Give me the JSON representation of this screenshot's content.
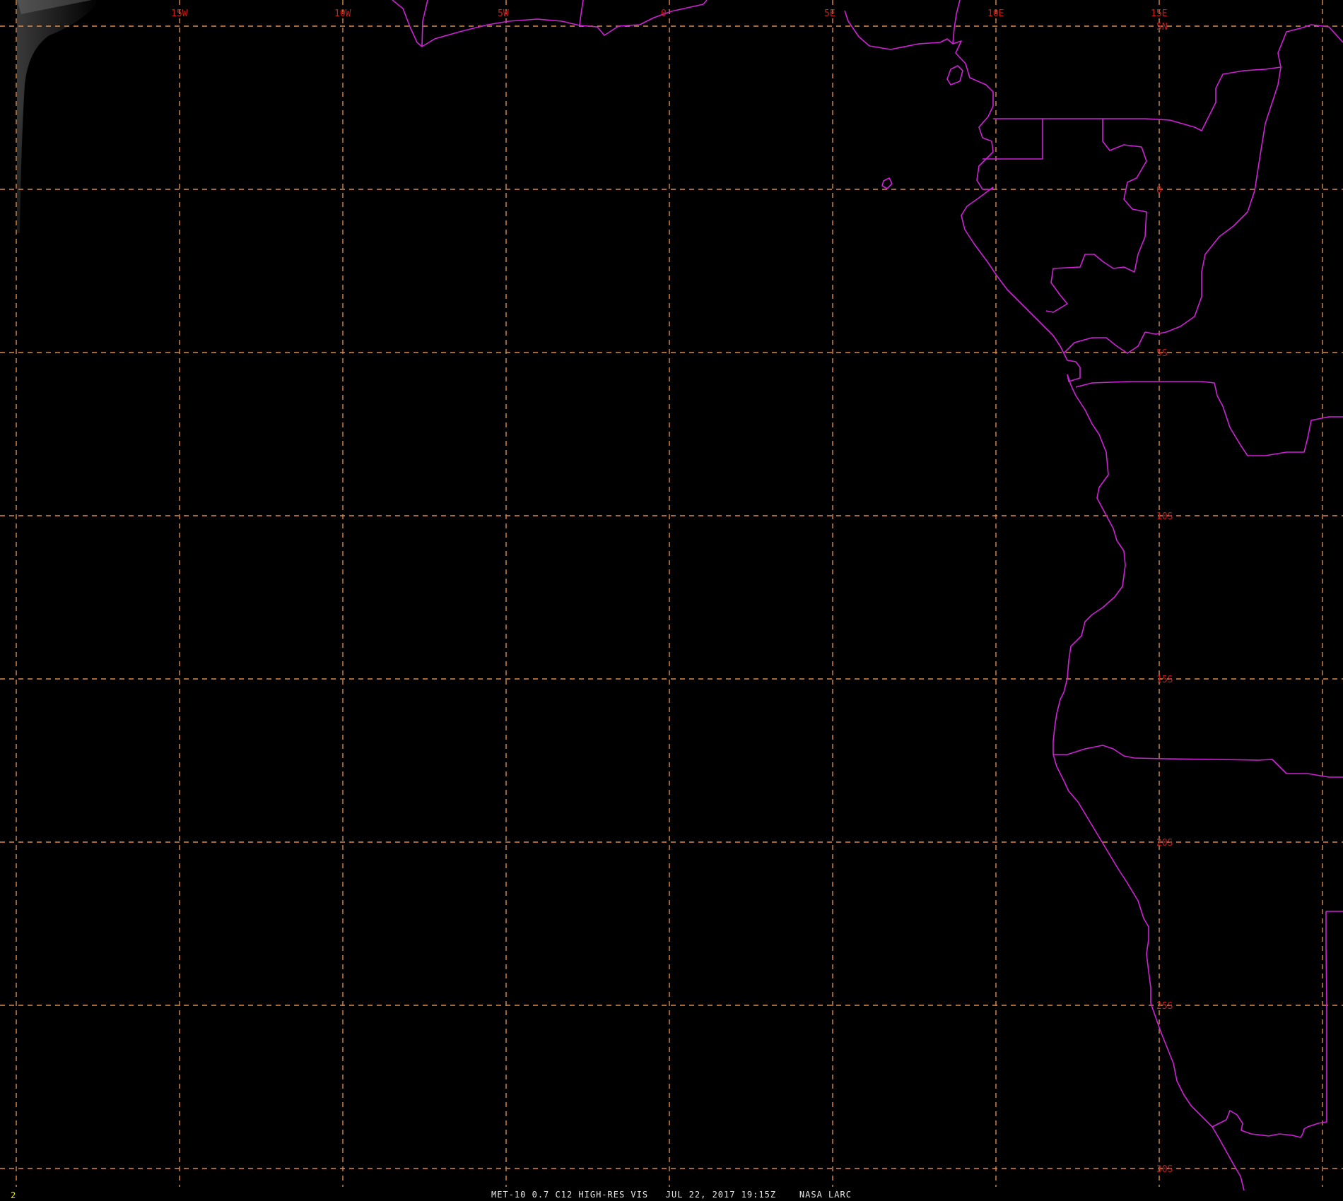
{
  "image": {
    "caption": "MET-10 0.7 C12 HIGH-RES VIS   JUL 22, 2017 19:15Z    NASA LARC",
    "frame_number": "2",
    "colors": {
      "background": "#000000",
      "grid": "#d98c4a",
      "grid_labels": "#cc1a1a",
      "boundaries": "#d020d8",
      "caption": "#e6e6e6",
      "frame_number": "#e8e800"
    }
  },
  "grid": {
    "longitudes": [
      {
        "lon": -20,
        "label": ""
      },
      {
        "lon": -15,
        "label": "15W"
      },
      {
        "lon": -10,
        "label": "10W"
      },
      {
        "lon": -5,
        "label": "5W"
      },
      {
        "lon": 0,
        "label": "0"
      },
      {
        "lon": 5,
        "label": "5E"
      },
      {
        "lon": 10,
        "label": "10E"
      },
      {
        "lon": 15,
        "label": "15E"
      },
      {
        "lon": 20,
        "label": ""
      }
    ],
    "latitudes": [
      {
        "lat": 5,
        "label": "5N"
      },
      {
        "lat": 0,
        "label": "0"
      },
      {
        "lat": -5,
        "label": "5S"
      },
      {
        "lat": -10,
        "label": "10S"
      },
      {
        "lat": -15,
        "label": "15S"
      },
      {
        "lat": -20,
        "label": "20S"
      },
      {
        "lat": -25,
        "label": "25S"
      },
      {
        "lat": -30,
        "label": "30S"
      }
    ]
  }
}
